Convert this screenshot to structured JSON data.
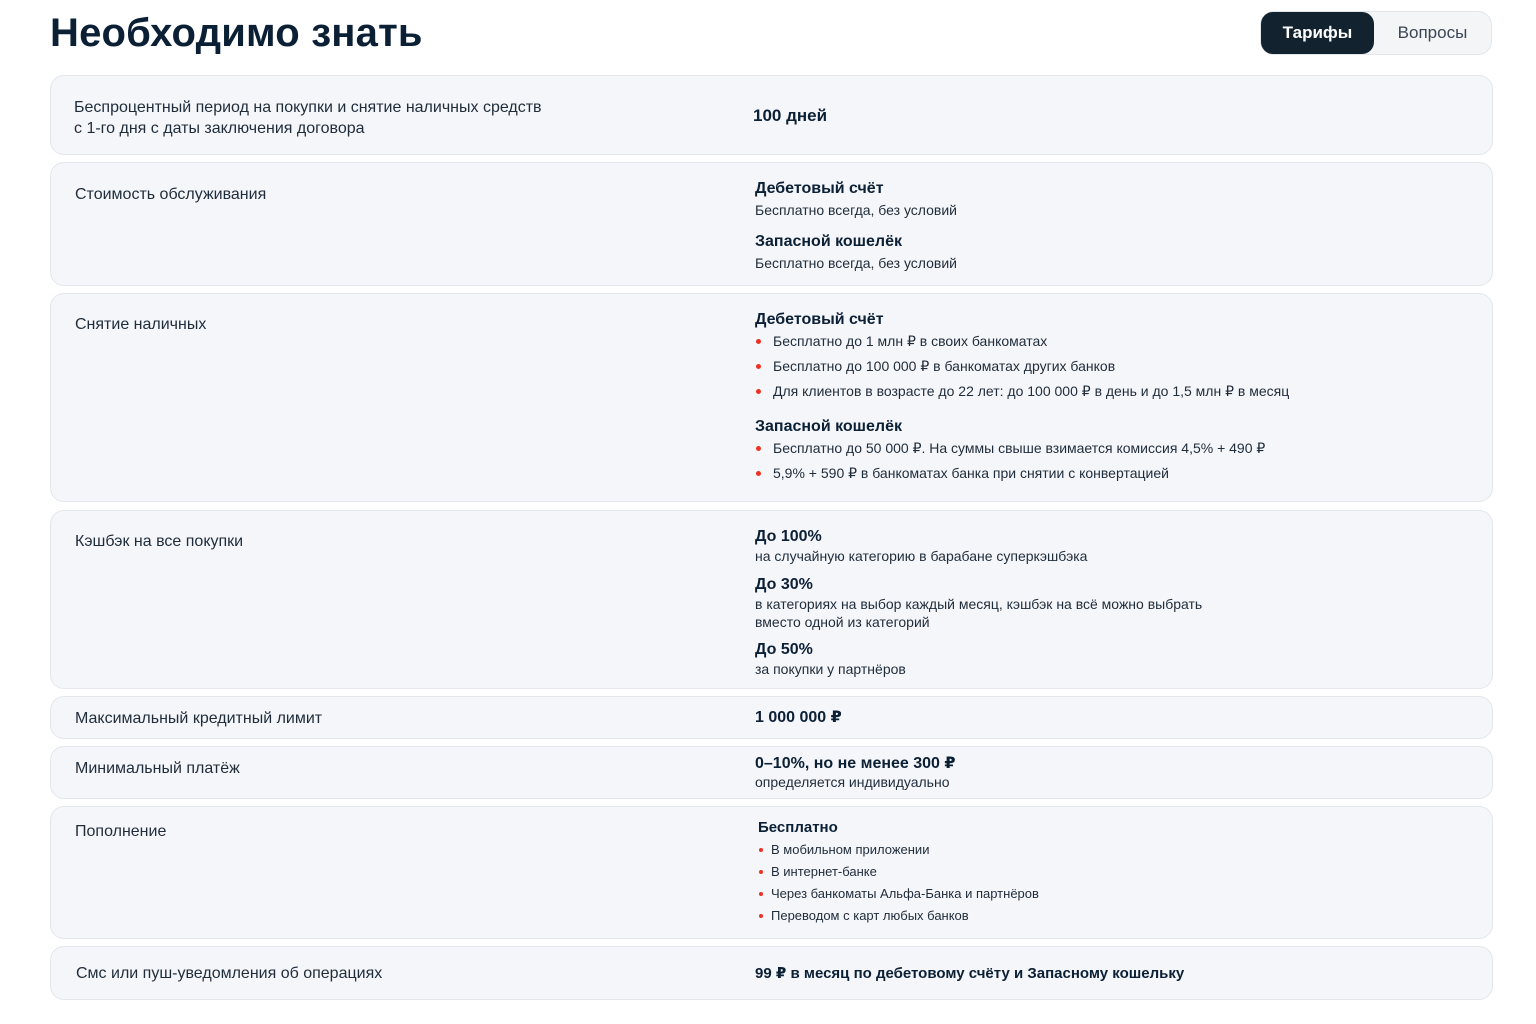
{
  "header": {
    "title": "Необходимо знать",
    "tabs": [
      {
        "label": "Тарифы",
        "active": true
      },
      {
        "label": "Вопросы",
        "active": false
      }
    ]
  },
  "rows": {
    "grace": {
      "label": "Беспроцентный период на покупки и снятие наличных средств\nс 1-го дня с даты заключения договора",
      "value": "100 дней"
    },
    "service": {
      "label": "Стоимость обслуживания",
      "debit_title": "Дебетовый счёт",
      "debit_text": "Бесплатно всегда, без условий",
      "spare_title": "Запасной кошелёк",
      "spare_text": "Бесплатно всегда, без условий"
    },
    "cash": {
      "label": "Снятие наличных",
      "debit_title": "Дебетовый счёт",
      "debit_items": [
        "Бесплатно до 1 млн ₽ в своих банкоматах",
        "Бесплатно до 100 000 ₽ в банкоматах других банков",
        "Для клиентов в возрасте до 22 лет: до 100 000 ₽ в день и до 1,5 млн ₽ в месяц"
      ],
      "spare_title": "Запасной кошелёк",
      "spare_items": [
        "Бесплатно до 50 000 ₽. На суммы свыше взимается комиссия 4,5% + 490 ₽",
        "5,9% + 590 ₽ в банкоматах банка при снятии с конвертацией"
      ]
    },
    "cashback": {
      "label": "Кэшбэк на все покупки",
      "items": [
        {
          "title": "До 100%",
          "text": "на случайную категорию в барабане суперкэшбэка"
        },
        {
          "title": "До 30%",
          "text": "в категориях на выбор каждый месяц, кэшбэк на всё можно выбрать\nвместо одной из категорий"
        },
        {
          "title": "До 50%",
          "text": "за покупки у партнёров"
        }
      ]
    },
    "limit": {
      "label": "Максимальный кредитный лимит",
      "value": "1 000 000 ₽"
    },
    "min_payment": {
      "label": "Минимальный платёж",
      "value": "0–10%, но не менее 300 ₽",
      "sub": "определяется индивидуально"
    },
    "topup": {
      "label": "Пополнение",
      "title": "Бесплатно",
      "items": [
        "В мобильном приложении",
        "В интернет-банке",
        "Через банкоматы Альфа-Банка и партнёров",
        "Переводом с карт любых банков"
      ]
    },
    "sms": {
      "label": "Смс или пуш-уведомления об операциях",
      "value": "99 ₽ в месяц по дебетовому счёту и Запасному кошельку"
    }
  },
  "colors": {
    "bullet": "#ef3124",
    "card_bg": "#f4f6f9",
    "active_tab_bg": "#13222f",
    "text": "#0b1f35"
  }
}
